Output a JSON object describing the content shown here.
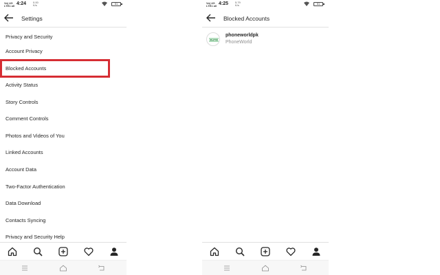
{
  "left": {
    "status": {
      "signal": "Vo) 4G\nLTE1 all",
      "time": "4:24",
      "speed": "0.00\nK/s",
      "battery": "51"
    },
    "title": "Settings",
    "menu": [
      "Privacy and Security",
      "Account Privacy",
      "Blocked Accounts",
      "Activity Status",
      "Story Controls",
      "Comment Controls",
      "Photos and Videos of You",
      "Linked Accounts",
      "Account Data",
      "Two-Factor Authentication",
      "Data Download",
      "Contacts Syncing",
      "Privacy and Security Help"
    ]
  },
  "right": {
    "status": {
      "signal": "Vo) 4G\nLTE1 all",
      "time": "4:25",
      "speed": "5.79\nK/s",
      "battery": "51"
    },
    "title": "Blocked Accounts",
    "blocked": [
      {
        "username": "phoneworldpk",
        "display_name": "PhoneWorld"
      }
    ]
  },
  "colors": {
    "highlight": "#d62d33",
    "accent_green": "#3aa655"
  },
  "icons": {
    "bottom_nav": [
      "home-icon",
      "search-icon",
      "new-post-icon",
      "heart-icon",
      "profile-icon"
    ],
    "system_nav": [
      "menu-icon",
      "home-key-icon",
      "back-key-icon"
    ]
  }
}
